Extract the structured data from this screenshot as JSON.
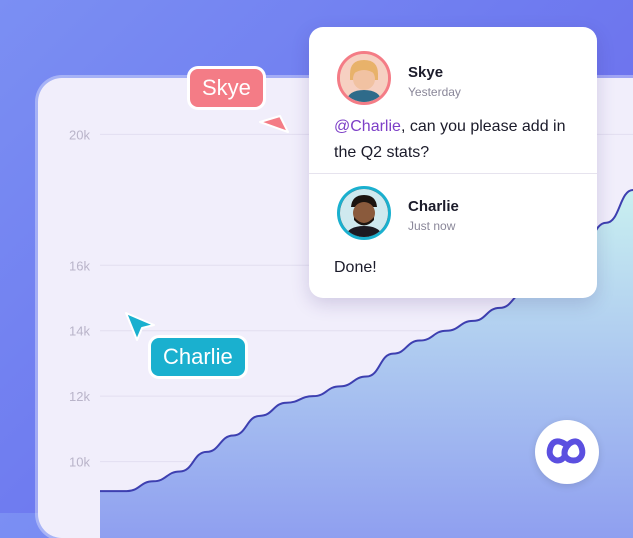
{
  "chart_data": {
    "type": "area",
    "y_ticks": [
      "10k",
      "12k",
      "14k",
      "16k",
      "20k"
    ],
    "ylim": [
      8400,
      20500
    ],
    "grid": true,
    "x": [
      0,
      1,
      2,
      3,
      4,
      5,
      6,
      7,
      8,
      9,
      10,
      11,
      12,
      13,
      14,
      15,
      16,
      17,
      18,
      19,
      20
    ],
    "values": [
      9100,
      9100,
      9400,
      9700,
      10300,
      10800,
      11400,
      11800,
      12000,
      12300,
      12600,
      13300,
      13700,
      14000,
      14300,
      14700,
      15200,
      15800,
      16500,
      17300,
      18300
    ],
    "colors": {
      "line": "#3d3fb0",
      "fill_top": "#c9f0f0",
      "fill_bottom": "#8f9ff0"
    }
  },
  "tags": {
    "skye": {
      "label": "Skye",
      "color": "#f47c86"
    },
    "charlie": {
      "label": "Charlie",
      "color": "#1ab0cf"
    }
  },
  "comments": [
    {
      "author": "Skye",
      "time": "Yesterday",
      "mention": "@Charlie",
      "text": ", can you please add in the Q2 stats?"
    },
    {
      "author": "Charlie",
      "time": "Just now",
      "text": "Done!"
    }
  ],
  "accent": "#7d3fc7",
  "logo_icon": "infinity-co-logo-icon"
}
